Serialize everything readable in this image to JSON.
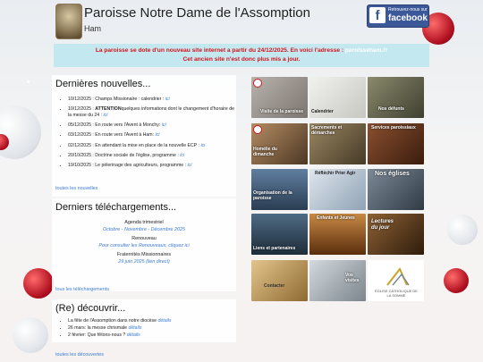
{
  "header": {
    "title": "Paroisse Notre Dame de l'Assomption",
    "subtitle": "Ham"
  },
  "facebook": {
    "small_text": "Retrouvez-nous sur",
    "label": "facebook"
  },
  "notice": {
    "line1": "La paroisse se dote d'un nouveau site internet a partir du 24/12/2025. En voici l'adresse : ",
    "link": "paroisseham.fr",
    "line2": "Cet ancien site n'est donc plus mis a jour."
  },
  "news": {
    "heading": "Dernières nouvelles...",
    "items": [
      {
        "text": "10/12/2025 : Champs Missionaire : calendrier : ",
        "link": "ici"
      },
      {
        "strong": "ATTENTION",
        "date": "10/12/2025 : ",
        "text": "quelques informations dont le changement d'horaire de la messe du 24 : ",
        "link": "ici"
      },
      {
        "text": "05/12/2025 : En route vers l'Avent à Monchy: ",
        "link": "ici"
      },
      {
        "text": "03/12/2025 : En route vers l'Avent à Ham: ",
        "link": "ici"
      },
      {
        "text": "02/12/2025 : En attendant la mise en place de la nouvelle ECP : ",
        "link": "ici"
      },
      {
        "text": "20/10/2025 : Doctrine sociale de l'église, programme : ",
        "link": "ici"
      },
      {
        "text": "19/10/2025 : Le pèlerinage des agriculteurs, programme : ",
        "link": "ici"
      }
    ],
    "all_link": "toutes les nouvelles"
  },
  "downloads": {
    "heading": "Derniers téléchargements...",
    "items": [
      {
        "title": "Agenda trimestriel",
        "sub": "Octobre - Novembre - Décembre 2025"
      },
      {
        "title": "Renouveau",
        "sub": "Pour consulter les Renouveaux, cliquez ici"
      },
      {
        "title": "Fraternités Missionnaires",
        "sub": "29 juin 2025 (lien direct)"
      }
    ],
    "all_link": "tous les téléchargements"
  },
  "discover": {
    "heading": "(Re) découvrir...",
    "items": [
      {
        "text": "La fête de l'Assomption dans notre diocèse ",
        "link": "détails"
      },
      {
        "text": "26 mars: la messe chrismale ",
        "link": "détails"
      },
      {
        "text": "2 février: Que fêtons-nous ? ",
        "link": "détails"
      }
    ],
    "all_link": "toutes les découvertes"
  },
  "tiles": [
    {
      "label": "Visite de la paroisse",
      "bg": "#9b9590"
    },
    {
      "label": "Calendrier",
      "bg": "#d9d9d4"
    },
    {
      "label": "Nos défunts",
      "bg": "#6a6a55"
    },
    {
      "label": "Homélie du dimanche",
      "bg": "#8a6d50"
    },
    {
      "label": "Sacrements et démarches",
      "bg": "#7b6a4c"
    },
    {
      "label": "Services paroissiaux",
      "bg": "#6e3f25"
    },
    {
      "label": "Organisation de la paroisse",
      "bg": "#3d5570"
    },
    {
      "label": "Réfléchir Prier Agir",
      "bg": "#b9c7d6"
    },
    {
      "label": "Nos églises",
      "bg": "#53606e"
    },
    {
      "label": "Liens et partenaires",
      "bg": "#344a5c"
    },
    {
      "label": "Enfants et Jeunes",
      "bg": "#8a4d1c"
    },
    {
      "label": "Lectures du jour",
      "bg": "#5c3b22"
    },
    {
      "label": "Contacter",
      "bg": "#c9a469"
    },
    {
      "label": "Vos visites",
      "bg": "#aab3bb"
    },
    {
      "label": "ÉGLISE CATHOLIQUE DE LA SOMME",
      "bg": "#ffffff"
    }
  ],
  "colors": {
    "notice_bg": "#c4e8f0",
    "notice_text": "#d6131b",
    "link": "#3a7bd5",
    "facebook": "#3b5998"
  }
}
